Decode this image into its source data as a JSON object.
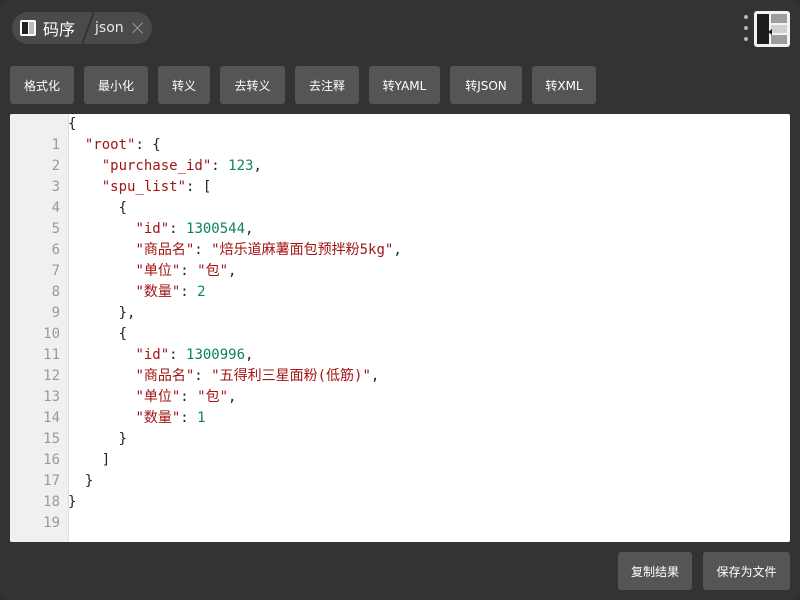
{
  "header": {
    "app_name": "码序",
    "tab_label": "json"
  },
  "toolbar": {
    "buttons": [
      {
        "label": "格式化"
      },
      {
        "label": "最小化"
      },
      {
        "label": "转义"
      },
      {
        "label": "去转义"
      },
      {
        "label": "去注释"
      },
      {
        "label": "转YAML"
      },
      {
        "label": "转JSON"
      },
      {
        "label": "转XML"
      }
    ]
  },
  "editor": {
    "line_numbers": [
      "1",
      "2",
      "3",
      "4",
      "5",
      "6",
      "7",
      "8",
      "9",
      "10",
      "11",
      "12",
      "13",
      "14",
      "15",
      "16",
      "17",
      "18",
      "19"
    ],
    "lines": [
      {
        "indent": "",
        "tokens": [
          {
            "t": "{",
            "c": "p"
          }
        ]
      },
      {
        "indent": "  ",
        "tokens": [
          {
            "t": "\"root\"",
            "c": "k"
          },
          {
            "t": ": {",
            "c": "p"
          }
        ]
      },
      {
        "indent": "    ",
        "tokens": [
          {
            "t": "\"purchase_id\"",
            "c": "k"
          },
          {
            "t": ": ",
            "c": "p"
          },
          {
            "t": "123",
            "c": "n"
          },
          {
            "t": ",",
            "c": "p"
          }
        ]
      },
      {
        "indent": "    ",
        "tokens": [
          {
            "t": "\"spu_list\"",
            "c": "k"
          },
          {
            "t": ": [",
            "c": "p"
          }
        ]
      },
      {
        "indent": "      ",
        "tokens": [
          {
            "t": "{",
            "c": "p"
          }
        ]
      },
      {
        "indent": "        ",
        "tokens": [
          {
            "t": "\"id\"",
            "c": "k"
          },
          {
            "t": ": ",
            "c": "p"
          },
          {
            "t": "1300544",
            "c": "n"
          },
          {
            "t": ",",
            "c": "p"
          }
        ]
      },
      {
        "indent": "        ",
        "tokens": [
          {
            "t": "\"商品名\"",
            "c": "k"
          },
          {
            "t": ": ",
            "c": "p"
          },
          {
            "t": "\"焙乐道麻薯面包预拌粉5kg\"",
            "c": "s"
          },
          {
            "t": ",",
            "c": "p"
          }
        ]
      },
      {
        "indent": "        ",
        "tokens": [
          {
            "t": "\"单位\"",
            "c": "k"
          },
          {
            "t": ": ",
            "c": "p"
          },
          {
            "t": "\"包\"",
            "c": "s"
          },
          {
            "t": ",",
            "c": "p"
          }
        ]
      },
      {
        "indent": "        ",
        "tokens": [
          {
            "t": "\"数量\"",
            "c": "k"
          },
          {
            "t": ": ",
            "c": "p"
          },
          {
            "t": "2",
            "c": "n"
          }
        ]
      },
      {
        "indent": "      ",
        "tokens": [
          {
            "t": "},",
            "c": "p"
          }
        ]
      },
      {
        "indent": "      ",
        "tokens": [
          {
            "t": "{",
            "c": "p"
          }
        ]
      },
      {
        "indent": "        ",
        "tokens": [
          {
            "t": "\"id\"",
            "c": "k"
          },
          {
            "t": ": ",
            "c": "p"
          },
          {
            "t": "1300996",
            "c": "n"
          },
          {
            "t": ",",
            "c": "p"
          }
        ]
      },
      {
        "indent": "        ",
        "tokens": [
          {
            "t": "\"商品名\"",
            "c": "k"
          },
          {
            "t": ": ",
            "c": "p"
          },
          {
            "t": "\"五得利三星面粉(低筋)\"",
            "c": "s"
          },
          {
            "t": ",",
            "c": "p"
          }
        ]
      },
      {
        "indent": "        ",
        "tokens": [
          {
            "t": "\"单位\"",
            "c": "k"
          },
          {
            "t": ": ",
            "c": "p"
          },
          {
            "t": "\"包\"",
            "c": "s"
          },
          {
            "t": ",",
            "c": "p"
          }
        ]
      },
      {
        "indent": "        ",
        "tokens": [
          {
            "t": "\"数量\"",
            "c": "k"
          },
          {
            "t": ": ",
            "c": "p"
          },
          {
            "t": "1",
            "c": "n"
          }
        ]
      },
      {
        "indent": "      ",
        "tokens": [
          {
            "t": "}",
            "c": "p"
          }
        ]
      },
      {
        "indent": "    ",
        "tokens": [
          {
            "t": "]",
            "c": "p"
          }
        ]
      },
      {
        "indent": "  ",
        "tokens": [
          {
            "t": "}",
            "c": "p"
          }
        ]
      },
      {
        "indent": "",
        "tokens": [
          {
            "t": "}",
            "c": "p"
          }
        ]
      },
      {
        "indent": "",
        "tokens": []
      }
    ]
  },
  "footer": {
    "copy_label": "复制结果",
    "save_label": "保存为文件"
  },
  "colors": {
    "key": "#a31515",
    "string": "#a31515",
    "number": "#098658",
    "button_bg": "#555555",
    "window_bg": "#333333"
  }
}
